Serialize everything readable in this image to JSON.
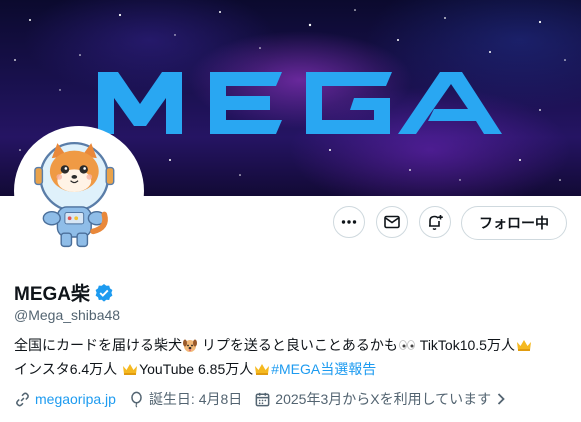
{
  "banner": {
    "logo_text": "MEGA"
  },
  "profile": {
    "name": "MEGA柴",
    "verified_icon": "verified-badge-icon",
    "handle": "@Mega_shiba48",
    "bio": {
      "part1": "全国にカードを届ける柴犬",
      "part2": " リプを送ると良いことあるかも",
      "part3": " TikTok10.5万人",
      "part4": "インスタ6.4万人 ",
      "part5": "YouTube 6.85万人",
      "hashtag": "#MEGA当選報告"
    },
    "website": "megaoripa.jp",
    "birthday": "誕生日: 4月8日",
    "joined": "2025年3月からXを利用しています"
  },
  "actions": {
    "more_icon": "more-icon",
    "message_icon": "mail-icon",
    "notify_icon": "bell-plus-icon",
    "follow_label": "フォロー中"
  },
  "colors": {
    "accent": "#1d9bf0",
    "text": "#0f1419",
    "muted": "#536471",
    "logo": "#29a7f2"
  }
}
